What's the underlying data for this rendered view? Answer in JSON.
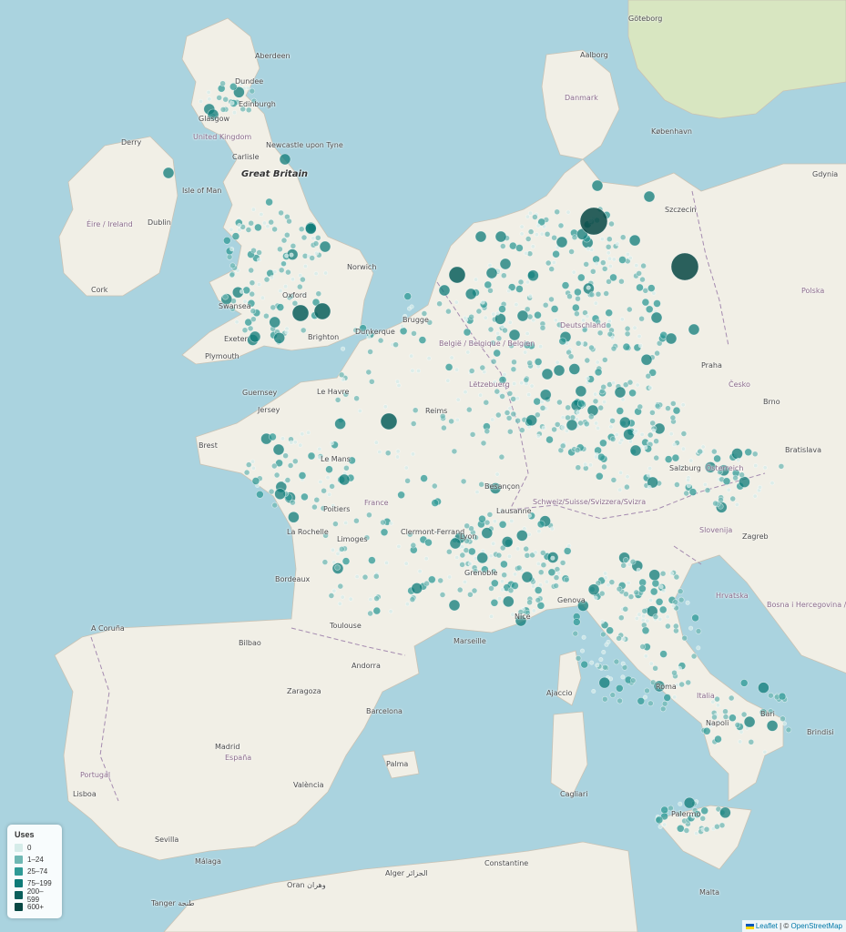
{
  "colors": {
    "sea": "#aad3df",
    "land": "#f1efe6",
    "tier_0": "#d5ece9",
    "tier_1_24": "#6fb8b4",
    "tier_25_74": "#2f9a96",
    "tier_75_199": "#0e7b78",
    "tier_200_599": "#0a5f5c",
    "tier_600_plus": "#074743"
  },
  "legend": {
    "title": "Uses",
    "items": [
      {
        "label": "0",
        "color": "#d5ece9"
      },
      {
        "label": "1–24",
        "color": "#6fb8b4"
      },
      {
        "label": "25–74",
        "color": "#2f9a96"
      },
      {
        "label": "75–199",
        "color": "#0e7b78"
      },
      {
        "label": "200–599",
        "color": "#0a5f5c"
      },
      {
        "label": "600+",
        "color": "#074743"
      }
    ]
  },
  "attribution": {
    "leaflet": "Leaflet",
    "separator": " | © ",
    "osm": "OpenStreetMap"
  },
  "labels": {
    "great_britain": "Great Britain",
    "united_kingdom": "United Kingdom",
    "isle_of_man": "Isle of Man",
    "eire": "Éire / Ireland",
    "dublin": "Dublin",
    "cork": "Cork",
    "derry": "Derry",
    "edinburgh": "Edinburgh",
    "glasgow": "Glasgow",
    "aberdeen": "Aberdeen",
    "dundee": "Dundee",
    "carlisle": "Carlisle",
    "newcastle": "Newcastle upon Tyne",
    "norwich": "Norwich",
    "oxford": "Oxford",
    "swansea": "Swansea",
    "exeter": "Exeter",
    "plymouth": "Plymouth",
    "brighton": "Brighton",
    "dunkerque": "Dunkerque",
    "guernsey": "Guernsey",
    "jersey": "Jersey",
    "le_havre": "Le Havre",
    "france": "France",
    "brest": "Brest",
    "le_mans": "Le Mans",
    "poitiers": "Poitiers",
    "la_rochelle": "La Rochelle",
    "limoges": "Limoges",
    "bordeaux": "Bordeaux",
    "toulouse": "Toulouse",
    "clermont": "Clermont-Ferrand",
    "lyon": "Lyon",
    "grenoble": "Grenoble",
    "marseille": "Marseille",
    "nice": "Nice",
    "reims": "Reims",
    "besancon": "Besançon",
    "belgie": "België / Belgique / Belgien",
    "brugge": "Brugge",
    "letzebuerg": "Lëtzebuerg",
    "deutschland": "Deutschland",
    "praha": "Praha",
    "cesko": "Česko",
    "brno": "Brno",
    "bratislava": "Bratislava",
    "osterreich": "Österreich",
    "wien": "Wien",
    "salzburg": "Salzburg",
    "schweiz": "Schweiz/Suisse/Svizzera/Svizra",
    "lausanne": "Lausanne",
    "genova": "Genova",
    "italia": "Italia",
    "roma": "Roma",
    "napoli": "Napoli",
    "bari": "Bari",
    "brindisi": "Brindisi",
    "palermo": "Palermo",
    "malta": "Malta",
    "cagliari": "Cagliari",
    "ajaccio": "Ajaccio",
    "slovenija": "Slovenija",
    "zagreb": "Zagreb",
    "hrvatska": "Hrvatska",
    "bosna": "Bosna i Hercegovina / Босна и Херцеговина",
    "polska": "Polska",
    "gdynia": "Gdynia",
    "szczecin": "Szczecin",
    "danmark": "Danmark",
    "kobenhavn": "København",
    "goteborg": "Göteborg",
    "aalborg": "Aalborg",
    "espana": "España",
    "madrid": "Madrid",
    "portugal": "Portugal",
    "lisboa": "Lisboa",
    "barcelona": "Barcelona",
    "zaragoza": "Zaragoza",
    "valencia": "València",
    "sevilla": "Sevilla",
    "malaga": "Málaga",
    "bilbao": "Bilbao",
    "a_coruna": "A Coruña",
    "andorra": "Andorra",
    "palma": "Palma",
    "alger": "Alger الجزائر",
    "oran": "Oran وهران",
    "constantine": "Constantine",
    "tanger": "Tanger طنجة"
  }
}
